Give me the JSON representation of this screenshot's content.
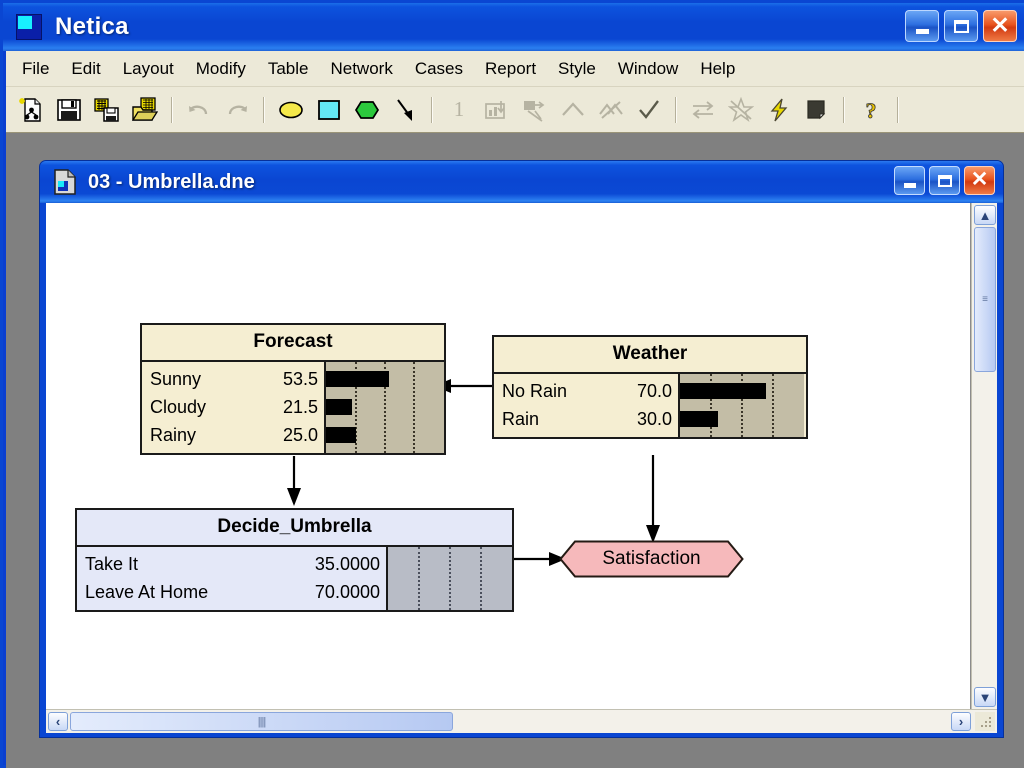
{
  "app": {
    "title": "Netica",
    "icon": "netica-app-icon",
    "window_controls": [
      {
        "name": "minimize-button",
        "glyph": "_"
      },
      {
        "name": "maximize-button",
        "glyph": "□"
      },
      {
        "name": "close-button",
        "glyph": "✕"
      }
    ]
  },
  "menubar": {
    "items": [
      "File",
      "Edit",
      "Layout",
      "Modify",
      "Table",
      "Network",
      "Cases",
      "Report",
      "Style",
      "Window",
      "Help"
    ]
  },
  "toolbar": {
    "groups": [
      {
        "buttons": [
          {
            "name": "new-network-icon",
            "tooltip": "New Network",
            "enabled": true
          },
          {
            "name": "save-icon",
            "tooltip": "Save",
            "enabled": true
          },
          {
            "name": "save-as-icon",
            "tooltip": "Save As",
            "enabled": true
          },
          {
            "name": "open-icon",
            "tooltip": "Open",
            "enabled": true
          }
        ]
      },
      {
        "buttons": [
          {
            "name": "undo-icon",
            "tooltip": "Undo",
            "enabled": false
          },
          {
            "name": "redo-icon",
            "tooltip": "Redo",
            "enabled": false
          }
        ]
      },
      {
        "buttons": [
          {
            "name": "nature-node-icon",
            "tooltip": "Nature Node",
            "enabled": true
          },
          {
            "name": "decision-node-icon",
            "tooltip": "Decision Node",
            "enabled": true
          },
          {
            "name": "utility-node-icon",
            "tooltip": "Utility Node",
            "enabled": true
          },
          {
            "name": "link-arrow-icon",
            "tooltip": "Add Link",
            "enabled": true
          }
        ]
      },
      {
        "buttons": [
          {
            "name": "one-icon",
            "label": "1",
            "tooltip": "Single Case",
            "enabled": false
          },
          {
            "name": "compile-icon",
            "tooltip": "Compile",
            "enabled": false
          },
          {
            "name": "enter-finding-icon",
            "tooltip": "Enter Finding",
            "enabled": false
          },
          {
            "name": "retract-icon",
            "tooltip": "Retract",
            "enabled": false
          },
          {
            "name": "retract-all-icon",
            "tooltip": "Retract All Findings",
            "enabled": false
          },
          {
            "name": "check-icon",
            "tooltip": "Accept",
            "enabled": true
          }
        ]
      },
      {
        "buttons": [
          {
            "name": "swap-icon",
            "tooltip": "Reverse Link",
            "enabled": false
          },
          {
            "name": "star-burst-icon",
            "tooltip": "Absorb Nodes",
            "enabled": false
          },
          {
            "name": "lightning-icon",
            "tooltip": "Fast Update",
            "enabled": true
          },
          {
            "name": "fill-icon",
            "tooltip": "Node Fill",
            "enabled": true
          }
        ]
      },
      {
        "buttons": [
          {
            "name": "help-icon",
            "label": "?",
            "tooltip": "Help",
            "enabled": true
          }
        ]
      }
    ]
  },
  "document": {
    "title": "03 - Umbrella.dne",
    "icon": "document-icon",
    "window_controls": [
      {
        "name": "doc-minimize-button",
        "glyph": "_"
      },
      {
        "name": "doc-maximize-button",
        "glyph": "□"
      },
      {
        "name": "doc-close-button",
        "glyph": "✕"
      }
    ]
  },
  "scrollbars": {
    "vertical": {
      "up": "▲",
      "down": "▼",
      "thumb_grip": "≡"
    },
    "horizontal": {
      "left": "‹",
      "right": "›",
      "thumb_grip": "||||"
    }
  },
  "network": {
    "nodes": [
      {
        "id": "forecast",
        "name": "Forecast",
        "type": "chance",
        "title": "Forecast",
        "states": [
          {
            "label": "Sunny",
            "value": "53.5",
            "percent": 53.5
          },
          {
            "label": "Cloudy",
            "value": "21.5",
            "percent": 21.5
          },
          {
            "label": "Rainy",
            "value": "25.0",
            "percent": 25.0
          }
        ]
      },
      {
        "id": "weather",
        "name": "Weather",
        "type": "chance",
        "title": "Weather",
        "states": [
          {
            "label": "No Rain",
            "value": "70.0",
            "percent": 70.0
          },
          {
            "label": "Rain",
            "value": "30.0",
            "percent": 30.0
          }
        ]
      },
      {
        "id": "decide_umbrella",
        "name": "Decide_Umbrella",
        "type": "decision",
        "title": "Decide_Umbrella",
        "states": [
          {
            "label": "Take It",
            "value": "35.0000",
            "percent": 0
          },
          {
            "label": "Leave At Home",
            "value": "70.0000",
            "percent": 0
          }
        ]
      },
      {
        "id": "satisfaction",
        "name": "Satisfaction",
        "type": "utility",
        "title": "Satisfaction"
      }
    ],
    "links": [
      {
        "from": "weather",
        "to": "forecast"
      },
      {
        "from": "forecast",
        "to": "decide_umbrella"
      },
      {
        "from": "weather",
        "to": "satisfaction"
      },
      {
        "from": "decide_umbrella",
        "to": "satisfaction"
      }
    ]
  },
  "colors": {
    "titlebar_blue": "#0a46d2",
    "chance_node_fill": "#f5eed2",
    "decision_node_fill": "#e4e8f8",
    "utility_node_fill": "#f6b9bb",
    "bar_track": "#c3bda6",
    "bar_track_grey": "#b8bcc6",
    "menu_bg": "#ece9d8",
    "mdi_bg": "#808080"
  }
}
